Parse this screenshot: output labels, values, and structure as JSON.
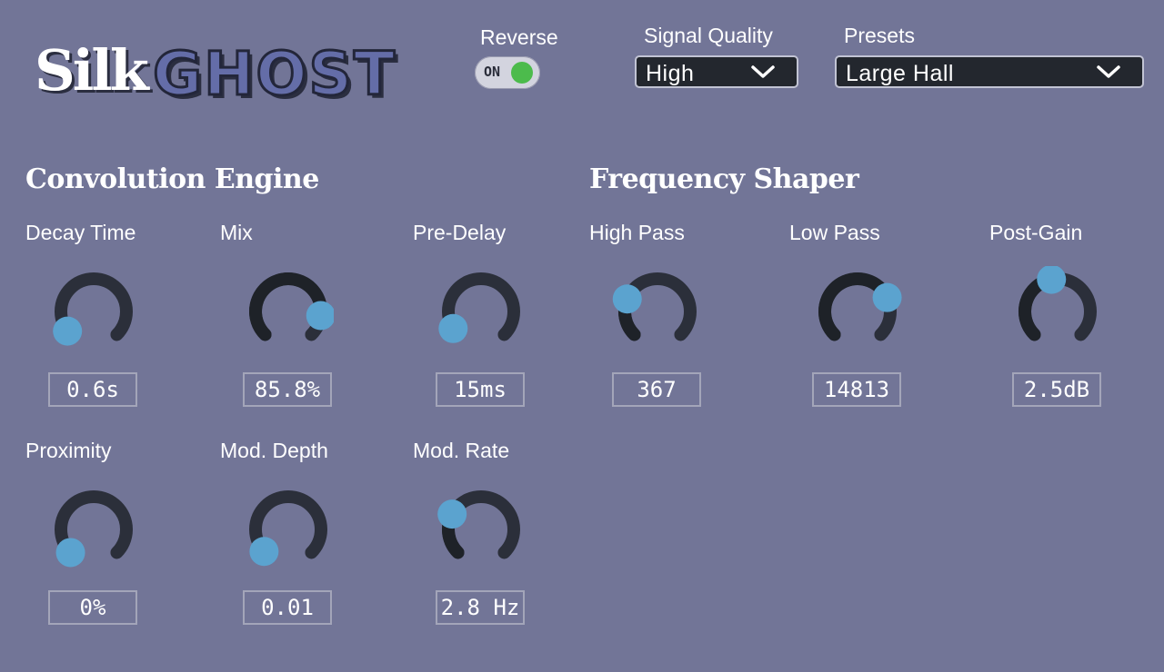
{
  "logo": {
    "part1": "Silk",
    "part2": "GHOST"
  },
  "header": {
    "reverse": {
      "label": "Reverse",
      "toggle_text": "ON",
      "state": "on"
    },
    "signal_quality": {
      "label": "Signal Quality",
      "value": "High"
    },
    "presets": {
      "label": "Presets",
      "value": "Large Hall"
    }
  },
  "sections": {
    "convolution": {
      "title": "Convolution Engine"
    },
    "frequency": {
      "title": "Frequency Shaper"
    }
  },
  "knobs": {
    "decay_time": {
      "label": "Decay Time",
      "value": "0.6s",
      "position": 0.03
    },
    "mix": {
      "label": "Mix",
      "value": "85.8%",
      "position": 0.86
    },
    "pre_delay": {
      "label": "Pre-Delay",
      "value": "15ms",
      "position": 0.05
    },
    "high_pass": {
      "label": "High Pass",
      "value": "367",
      "position": 0.25
    },
    "low_pass": {
      "label": "Low Pass",
      "value": "14813",
      "position": 0.74
    },
    "post_gain": {
      "label": "Post-Gain",
      "value": "2.5dB",
      "position": 0.46
    },
    "proximity": {
      "label": "Proximity",
      "value": "0%",
      "position": 0.0
    },
    "mod_depth": {
      "label": "Mod. Depth",
      "value": "0.01",
      "position": 0.01
    },
    "mod_rate": {
      "label": "Mod. Rate",
      "value": "2.8 Hz",
      "position": 0.27
    }
  },
  "colors": {
    "background": "#727597",
    "knob_track": "#2b2f3a",
    "knob_fill": "#1e2228",
    "knob_handle": "#5ba3cf",
    "toggle_on": "#4cbb4c",
    "select_bg": "#23272e"
  },
  "icons": {
    "dropdown": "chevron-down-icon",
    "knob_handle": "knob-handle-icon"
  }
}
